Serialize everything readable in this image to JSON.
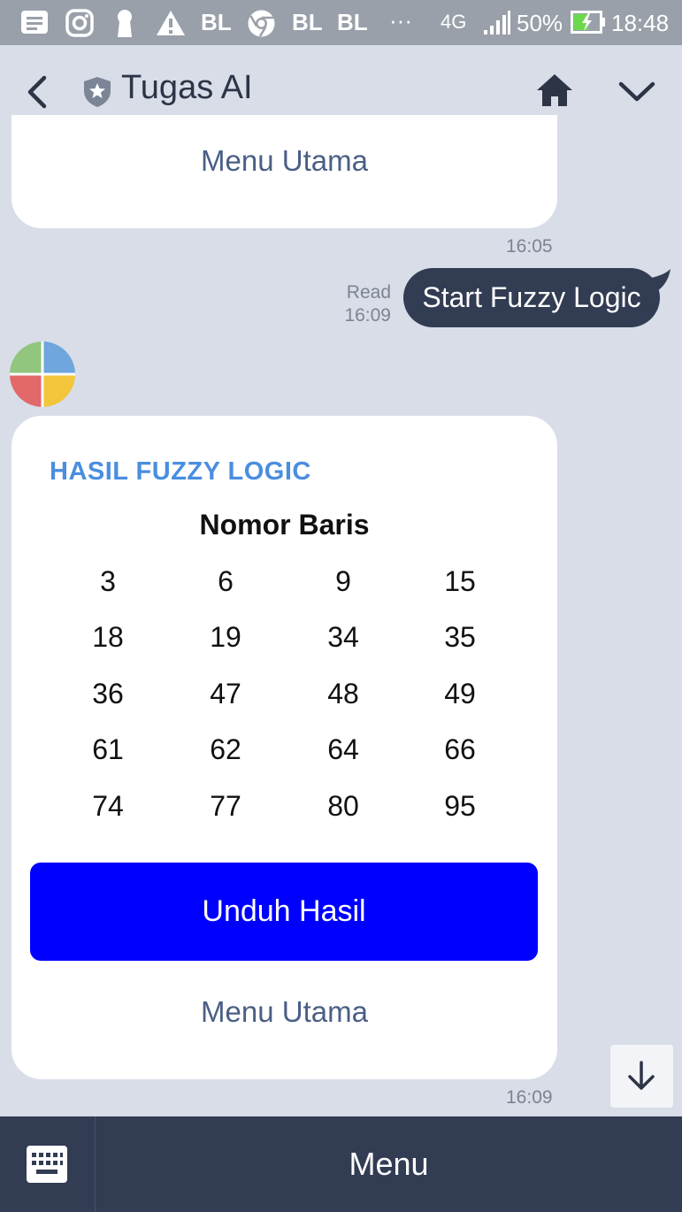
{
  "status_bar": {
    "bl_labels": [
      "BL",
      "BL",
      "BL"
    ],
    "dots": "···",
    "network": "4G",
    "battery": "50%",
    "clock": "18:48"
  },
  "header": {
    "title": "Tugas AI"
  },
  "chat": {
    "top_bubble": {
      "menu_label": "Menu Utama",
      "time": "16:05"
    },
    "outgoing": {
      "text": "Start Fuzzy Logic",
      "read_label": "Read",
      "time": "16:09"
    },
    "card": {
      "title": "HASIL FUZZY LOGIC",
      "subtitle": "Nomor Baris",
      "rows": [
        [
          "3",
          "6",
          "9",
          "15"
        ],
        [
          "18",
          "19",
          "34",
          "35"
        ],
        [
          "36",
          "47",
          "48",
          "49"
        ],
        [
          "61",
          "62",
          "64",
          "66"
        ],
        [
          "74",
          "77",
          "80",
          "95"
        ]
      ],
      "download_label": "Unduh Hasil",
      "menu_label": "Menu Utama",
      "time": "16:09"
    }
  },
  "bottom_bar": {
    "menu_label": "Menu"
  },
  "colors": {
    "background": "#d8dde8",
    "outgoing_bubble": "#323c53",
    "card_title": "#4a8ee0",
    "download_button": "#0000ff",
    "link": "#4a5f85"
  },
  "icons": [
    "message-icon",
    "instagram-icon",
    "keyhole-icon",
    "warning-icon",
    "chrome-icon",
    "back-icon",
    "shield-icon",
    "home-icon",
    "chevron-down-icon",
    "avatar",
    "arrow-down-icon",
    "keyboard-icon"
  ]
}
